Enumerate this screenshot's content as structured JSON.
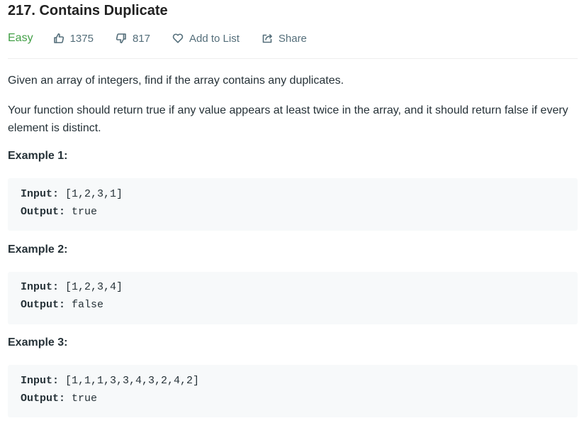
{
  "problem": {
    "title": "217. Contains Duplicate",
    "difficulty": "Easy",
    "likes": "1375",
    "dislikes": "817",
    "add_to_list_label": "Add to List",
    "share_label": "Share",
    "colors": {
      "difficulty_easy": "#43a047",
      "meta_text": "#546e7a",
      "code_bg": "#f7f9fa"
    },
    "icons": {
      "likes": "thumbs-up-icon",
      "dislikes": "thumbs-down-icon",
      "add_to_list": "heart-icon",
      "share": "share-icon"
    }
  },
  "description": {
    "paragraph1": "Given an array of integers, find if the array contains any duplicates.",
    "paragraph2": "Your function should return true if any value appears at least twice in the array, and it should return false if every element is distinct."
  },
  "examples": [
    {
      "title": "Example 1:",
      "input_label": "Input:",
      "input_value": "[1,2,3,1]",
      "output_label": "Output:",
      "output_value": "true"
    },
    {
      "title": "Example 2:",
      "input_label": "Input:",
      "input_value": "[1,2,3,4]",
      "output_label": "Output:",
      "output_value": "false"
    },
    {
      "title": "Example 3:",
      "input_label": "Input:",
      "input_value": "[1,1,1,3,3,4,3,2,4,2]",
      "output_label": "Output:",
      "output_value": "true"
    }
  ]
}
